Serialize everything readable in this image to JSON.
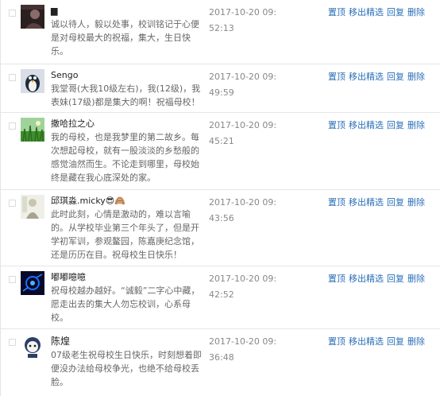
{
  "comments": [
    {
      "name": "▆",
      "text": "诚以待人，毅以处事，校训铭记于心便是对母校最大的祝福，集大，生日快乐。",
      "time": "2017-10-20 09:52:13",
      "avatar_icon": "dark-portrait-avatar"
    },
    {
      "name": "Sengo",
      "text": "我堂哥(大我10级左右)，我(12级)，我表妹(17级)都是集大的啊！祝福母校！",
      "time": "2017-10-20 09:49:59",
      "avatar_icon": "penguin-avatar"
    },
    {
      "name": "撒哈拉之心",
      "text": "我的母校，也是我梦里的第二故乡。每次想起母校，就有一股淡淡的乡愁般的感觉油然而生。不论走到哪里，母校始终是藏在我心底深处的家。",
      "time": "2017-10-20 09:45:21",
      "avatar_icon": "green-grass-avatar"
    },
    {
      "name": "邱琪淼.micky😎🙈",
      "text": "此时此刻，心情是激动的，难以言喻的。从学校毕业第三个年头了，但是开学初军训，参观鳌园，陈嘉庚纪念馆，还是历历在目。祝母校生日快乐！",
      "time": "2017-10-20 09:43:56",
      "avatar_icon": "sketch-figure-avatar"
    },
    {
      "name": "嘟嘟噫噫",
      "text": "祝母校越办越好。“诚毅”二字心中藏，愿走出去的集大人勿忘校训，心系母校。",
      "time": "2017-10-20 09:42:52",
      "avatar_icon": "dark-blue-avatar"
    },
    {
      "name": "陈煌",
      "text": "07级老生祝母校生日快乐，时刻想着即便没办法给母校争光，也绝不给母校丢脸。",
      "time": "2017-10-20 09:36:48",
      "avatar_icon": "cartoon-character-avatar"
    }
  ],
  "actions": {
    "pin": "置顶",
    "remove_featured": "移出精选",
    "reply": "回复",
    "delete": "删除"
  }
}
